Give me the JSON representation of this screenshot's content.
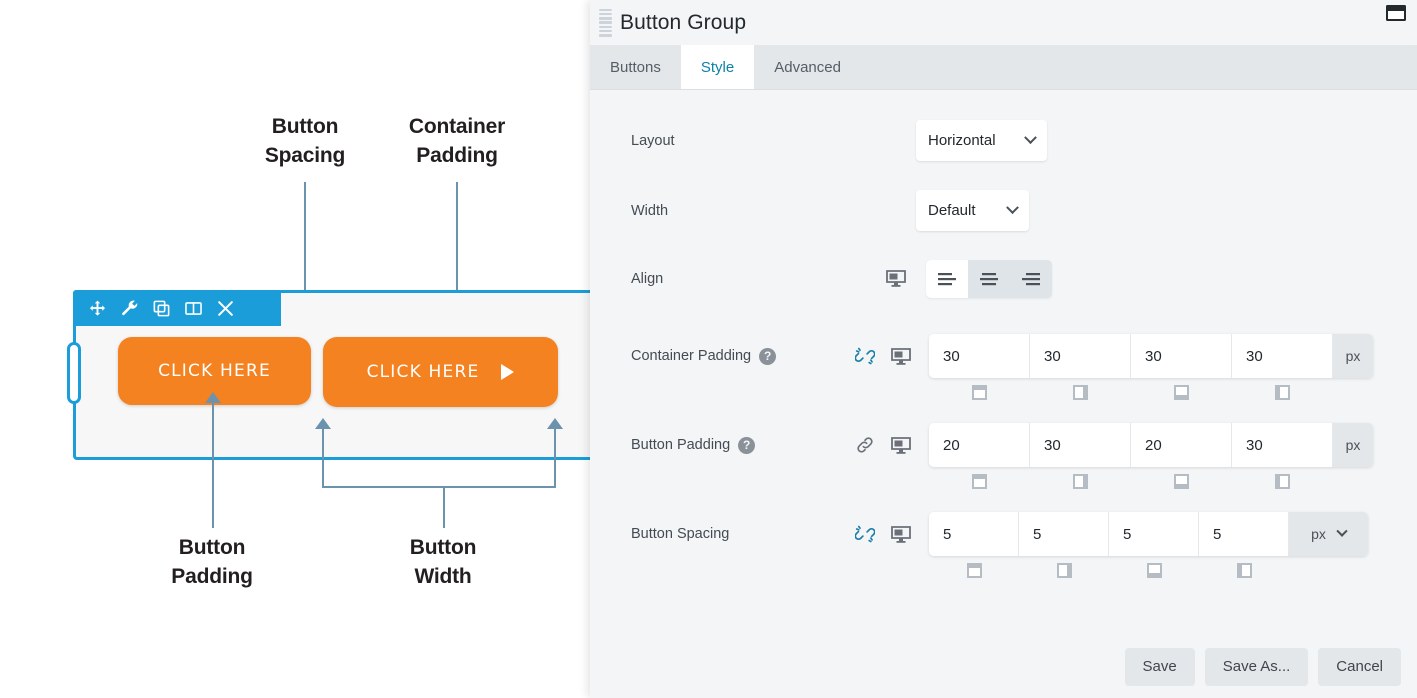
{
  "preview": {
    "annotations": [
      {
        "id": "button-spacing",
        "text": "Button\nSpacing"
      },
      {
        "id": "container-padding",
        "text": "Container\nPadding"
      },
      {
        "id": "button-padding",
        "text": "Button\nPadding"
      },
      {
        "id": "button-width",
        "text": "Button\nWidth"
      }
    ],
    "toolbar_icons": [
      "move-icon",
      "wrench-icon",
      "duplicate-icon",
      "columns-icon",
      "close-icon"
    ],
    "buttons": [
      {
        "label": "CLICK HERE",
        "has_arrow": false
      },
      {
        "label": "CLICK HERE",
        "has_arrow": true
      }
    ],
    "accent_color": "#1b9dd9",
    "button_color": "#f58220",
    "leader_color": "#6b93ad"
  },
  "panel": {
    "title": "Button Group",
    "window_control_icon": "restore-window-icon",
    "drag_handle_icon": "drag-handle-icon",
    "tabs": [
      {
        "label": "Buttons",
        "active": false
      },
      {
        "label": "Style",
        "active": true
      },
      {
        "label": "Advanced",
        "active": false
      }
    ],
    "active_tab_color": "#0d82a8",
    "fields": {
      "layout": {
        "label": "Layout",
        "value": "Horizontal"
      },
      "width": {
        "label": "Width",
        "value": "Default"
      },
      "align": {
        "label": "Align",
        "device_icon": "desktop-icon",
        "options": [
          {
            "name": "align-left",
            "selected": true
          },
          {
            "name": "align-center",
            "selected": false
          },
          {
            "name": "align-right",
            "selected": false
          }
        ]
      },
      "container_padding": {
        "label": "Container Padding",
        "help_icon": "help-icon",
        "link_icon": "unlink-icon",
        "linked": false,
        "device_icon": "desktop-icon",
        "values": [
          "30",
          "30",
          "30",
          "30"
        ],
        "unit": "px",
        "unit_is_dropdown": false,
        "sides": [
          "top",
          "right",
          "bottom",
          "left"
        ]
      },
      "button_padding": {
        "label": "Button Padding",
        "help_icon": "help-icon",
        "link_icon": "link-icon",
        "linked": true,
        "device_icon": "desktop-icon",
        "values": [
          "20",
          "30",
          "20",
          "30"
        ],
        "unit": "px",
        "unit_is_dropdown": false,
        "sides": [
          "top",
          "right",
          "bottom",
          "left"
        ]
      },
      "button_spacing": {
        "label": "Button Spacing",
        "link_icon": "unlink-icon",
        "linked": false,
        "device_icon": "desktop-icon",
        "values": [
          "5",
          "5",
          "5",
          "5"
        ],
        "unit": "px",
        "unit_is_dropdown": true,
        "sides": [
          "top",
          "right",
          "bottom",
          "left"
        ]
      }
    },
    "footer": {
      "save_label": "Save",
      "save_as_label": "Save As...",
      "cancel_label": "Cancel"
    }
  }
}
